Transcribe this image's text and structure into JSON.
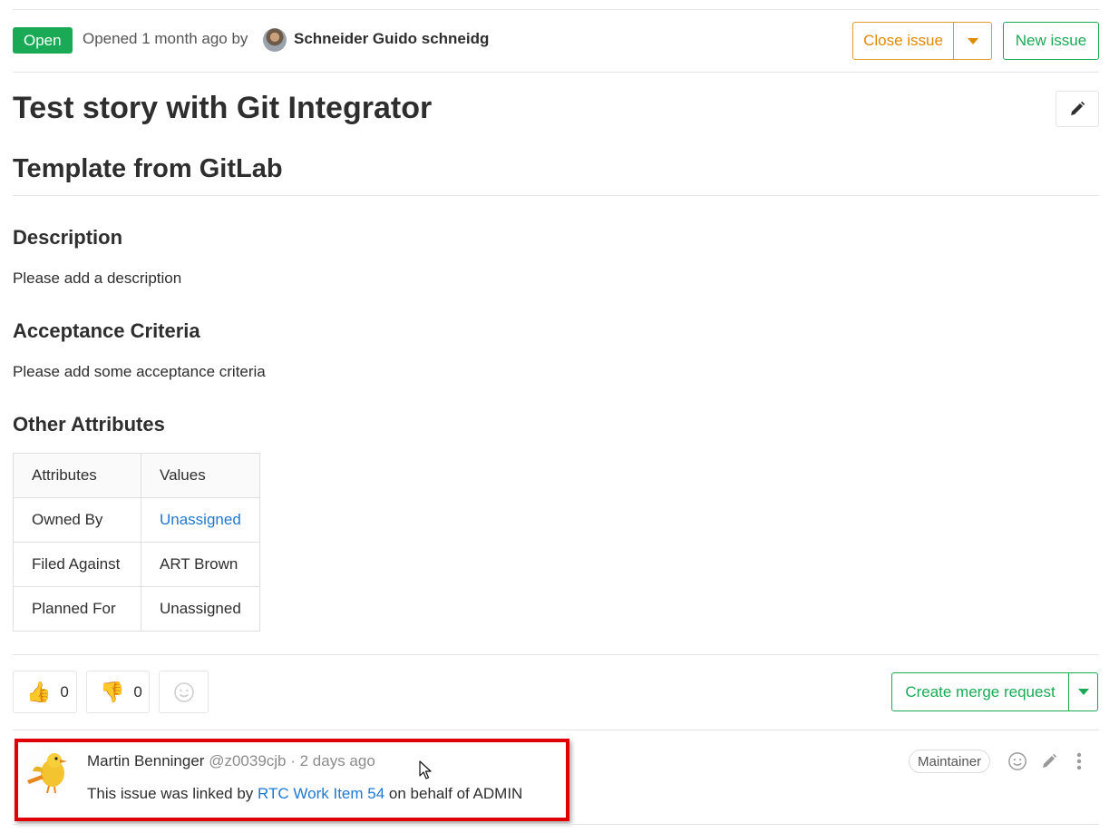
{
  "header": {
    "status": "Open",
    "opened_prefix": "Opened 1 month ago by",
    "author": "Schneider Guido schneidg",
    "close_issue_label": "Close issue",
    "new_issue_label": "New issue"
  },
  "issue": {
    "title": "Test story with Git Integrator"
  },
  "description": {
    "template_heading": "Template from GitLab",
    "description_heading": "Description",
    "description_text": "Please add a description",
    "acceptance_heading": "Acceptance Criteria",
    "acceptance_text": "Please add some acceptance criteria",
    "other_heading": "Other Attributes"
  },
  "attributes_table": {
    "headers": [
      "Attributes",
      "Values"
    ],
    "rows": [
      {
        "attribute": "Owned By",
        "value": "Unassigned"
      },
      {
        "attribute": "Filed Against",
        "value": "ART Brown"
      },
      {
        "attribute": "Planned For",
        "value": "Unassigned"
      }
    ]
  },
  "awards": {
    "thumbs_up_count": "0",
    "thumbs_down_count": "0",
    "create_mr_label": "Create merge request"
  },
  "note": {
    "author_name": "Martin Benninger",
    "meta": "@z0039cjb · 2 days ago",
    "body_prefix": "This issue was linked by",
    "link_text": "RTC Work Item 54",
    "body_suffix": "on behalf of ADMIN",
    "role": "Maintainer"
  },
  "colors": {
    "success": "#1aaa55",
    "warning": "#e08a00",
    "link": "#1f78d1",
    "highlight": "#e00000"
  }
}
